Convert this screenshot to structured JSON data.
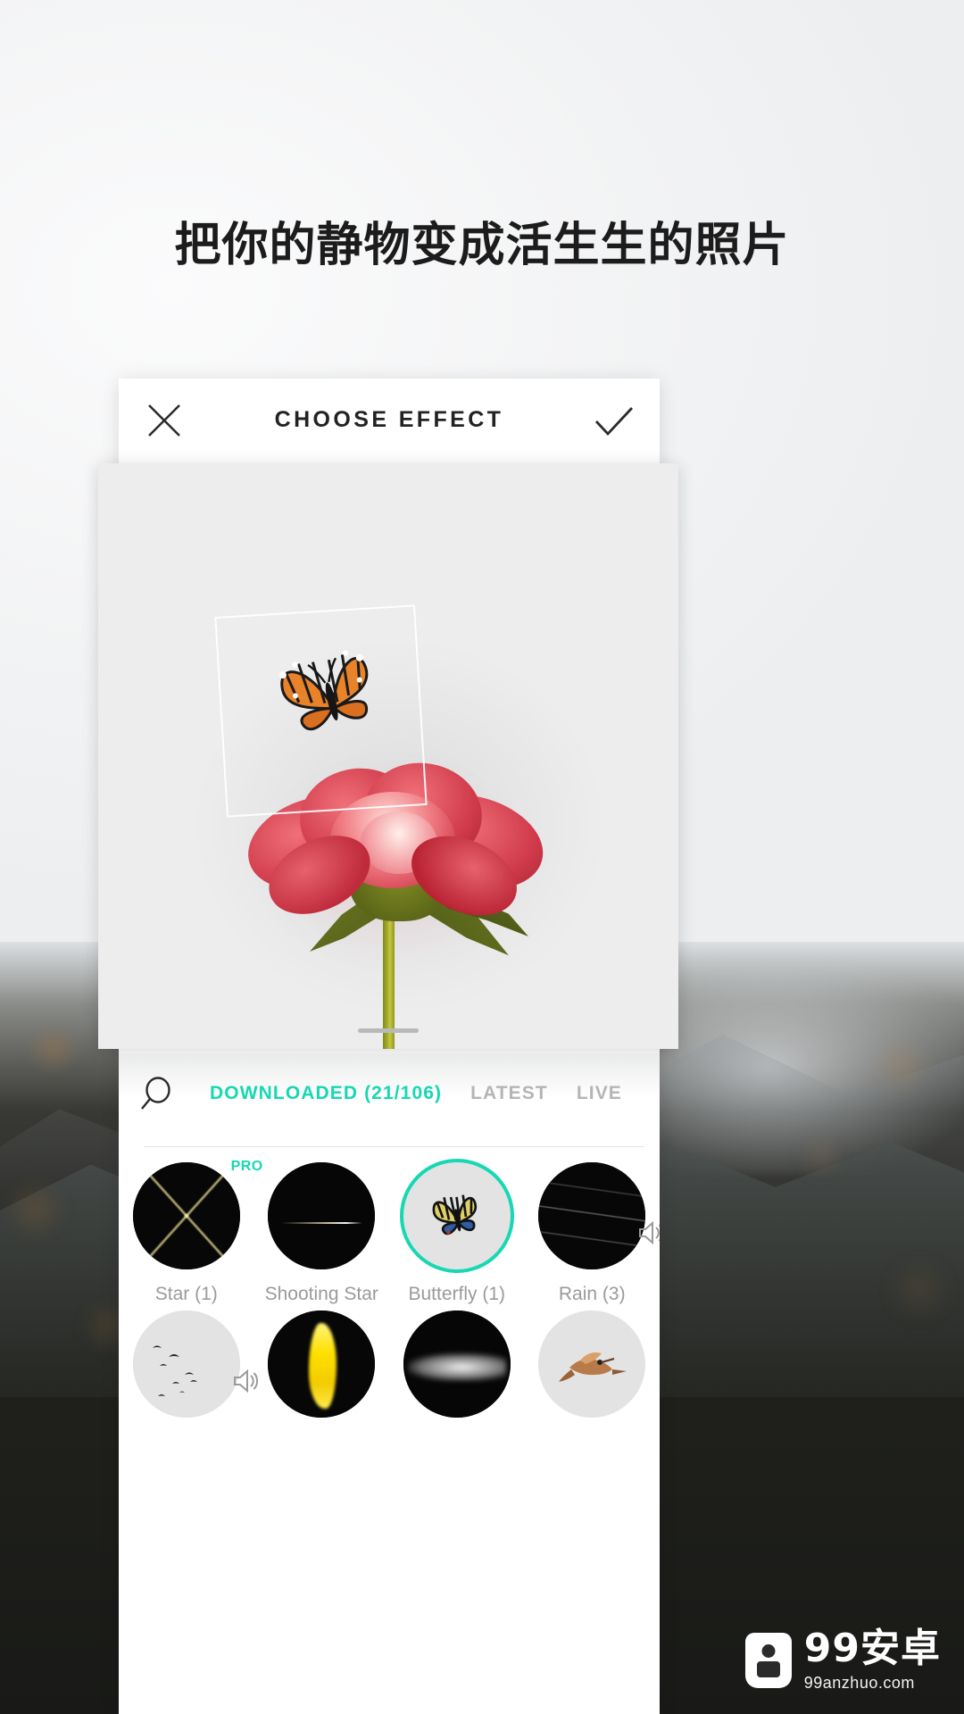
{
  "headline": "把你的静物变成活生生的照片",
  "colors": {
    "accent": "#16d8b2",
    "inactive_tab": "#b5b5b5",
    "label": "#9a9a9a",
    "headline": "#1c1c1c"
  },
  "app": {
    "header": {
      "title": "CHOOSE EFFECT",
      "close_icon": "close-icon",
      "confirm_icon": "check-icon"
    },
    "preview": {
      "selection_box": "effect-placement-box",
      "subject": "red-rose-photo",
      "overlay_effect": "butterfly"
    },
    "tabs": [
      {
        "label": "DOWNLOADED (21/106)",
        "active": true
      },
      {
        "label": "LATEST",
        "active": false
      },
      {
        "label": "LIVE",
        "active": false
      }
    ],
    "search_icon": "search-icon",
    "effects": [
      {
        "label": "Star (1)",
        "art": "art-star",
        "pro": true,
        "selected": false,
        "sound": false,
        "light": false
      },
      {
        "label": "Shooting Star",
        "art": "art-shooting",
        "pro": false,
        "selected": false,
        "sound": false,
        "light": false
      },
      {
        "label": "Butterfly (1)",
        "art": "art-butterfly",
        "pro": false,
        "selected": true,
        "sound": false,
        "light": true
      },
      {
        "label": "Rain (3)",
        "art": "art-rain",
        "pro": false,
        "selected": false,
        "sound": true,
        "light": false
      },
      {
        "label": "",
        "art": "art-birds",
        "pro": false,
        "selected": false,
        "sound": true,
        "light": true
      },
      {
        "label": "",
        "art": "art-fire",
        "pro": false,
        "selected": false,
        "sound": false,
        "light": false
      },
      {
        "label": "",
        "art": "art-smoke",
        "pro": false,
        "selected": false,
        "sound": false,
        "light": false
      },
      {
        "label": "",
        "art": "art-bird",
        "pro": false,
        "selected": false,
        "sound": false,
        "light": true
      }
    ],
    "pro_badge": "PRO"
  },
  "watermark": {
    "main": "99安卓",
    "sub": "99anzhuo.com"
  }
}
